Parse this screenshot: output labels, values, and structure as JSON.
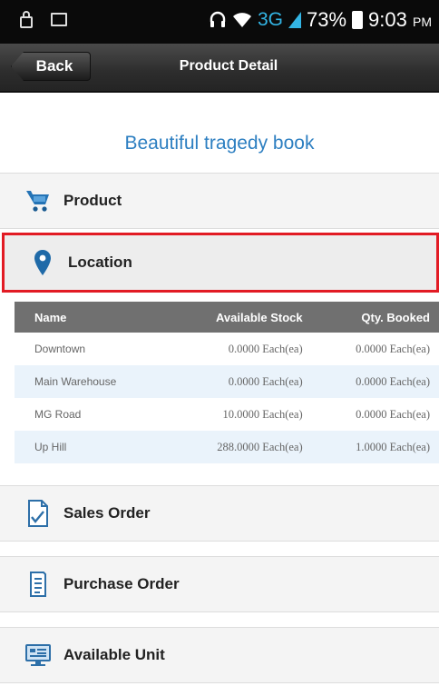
{
  "status_bar": {
    "network": "3G",
    "battery": "73%",
    "time": "9:03",
    "ampm": "PM"
  },
  "action_bar": {
    "back_label": "Back",
    "title": "Product Detail"
  },
  "product": {
    "title": "Beautiful tragedy book"
  },
  "sections": {
    "product": "Product",
    "location": "Location",
    "sales_order": "Sales Order",
    "purchase_order": "Purchase Order",
    "available_unit": "Available Unit"
  },
  "icons": {
    "product": "cart-icon",
    "location": "map-pin-icon",
    "sales_order": "document-check-icon",
    "purchase_order": "clipboard-list-icon",
    "available_unit": "monitor-icon"
  },
  "colors": {
    "accent_blue": "#2d7fc1",
    "highlight_red": "#e21b24",
    "table_header": "#707070"
  },
  "stock_table": {
    "headers": [
      "Name",
      "Available Stock",
      "Qty. Booked"
    ],
    "rows": [
      [
        "Downtown",
        "0.0000 Each(ea)",
        "0.0000 Each(ea)"
      ],
      [
        "Main Warehouse",
        "0.0000 Each(ea)",
        "0.0000 Each(ea)"
      ],
      [
        "MG Road",
        "10.0000 Each(ea)",
        "0.0000 Each(ea)"
      ],
      [
        "Up Hill",
        "288.0000 Each(ea)",
        "1.0000 Each(ea)"
      ]
    ]
  }
}
